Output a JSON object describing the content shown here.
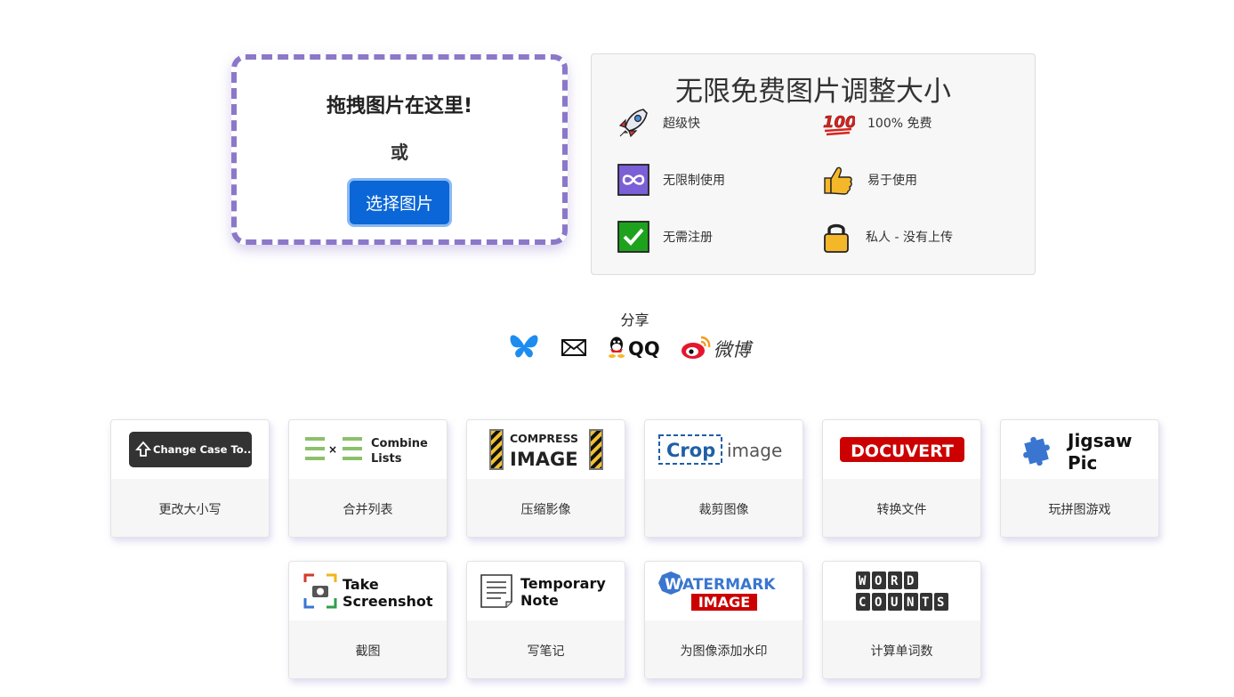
{
  "upload": {
    "drop_title": "拖拽图片在这里!",
    "or_text": "或",
    "select_button": "选择图片"
  },
  "features": {
    "title": "无限免费图片调整大小",
    "items": [
      {
        "icon": "rocket-icon",
        "label": "超级快"
      },
      {
        "icon": "hundred-icon",
        "label": "100% 免费"
      },
      {
        "icon": "infinity-icon",
        "label": "无限制使用"
      },
      {
        "icon": "thumbs-up-icon",
        "label": "易于使用"
      },
      {
        "icon": "check-icon",
        "label": "无需注册"
      },
      {
        "icon": "lock-icon",
        "label": "私人 - 没有上传"
      }
    ]
  },
  "share": {
    "label": "分享",
    "items": [
      {
        "icon": "bluesky-icon",
        "text": ""
      },
      {
        "icon": "email-icon",
        "text": ""
      },
      {
        "icon": "qq-icon",
        "text": "QQ"
      },
      {
        "icon": "weibo-icon",
        "text": "微博"
      }
    ]
  },
  "tools": [
    {
      "logo_text": "Change Case To...",
      "caption": "更改大小写"
    },
    {
      "logo_text": "Combine Lists",
      "caption": "合并列表"
    },
    {
      "logo_text": "COMPRESS IMAGE",
      "caption": "压缩影像"
    },
    {
      "logo_text": "Crop image",
      "caption": "裁剪图像"
    },
    {
      "logo_text": "DOCUVERT",
      "caption": "转换文件"
    },
    {
      "logo_text": "Jigsaw Pic",
      "caption": "玩拼图游戏"
    },
    {
      "logo_text": "Take Screenshot",
      "caption": "截图"
    },
    {
      "logo_text": "Temporary Note",
      "caption": "写笔记"
    },
    {
      "logo_text": "WATERMARK IMAGE",
      "caption": "为图像添加水印"
    },
    {
      "logo_text": "WORD COUNTS",
      "caption": "计算单词数"
    }
  ]
}
